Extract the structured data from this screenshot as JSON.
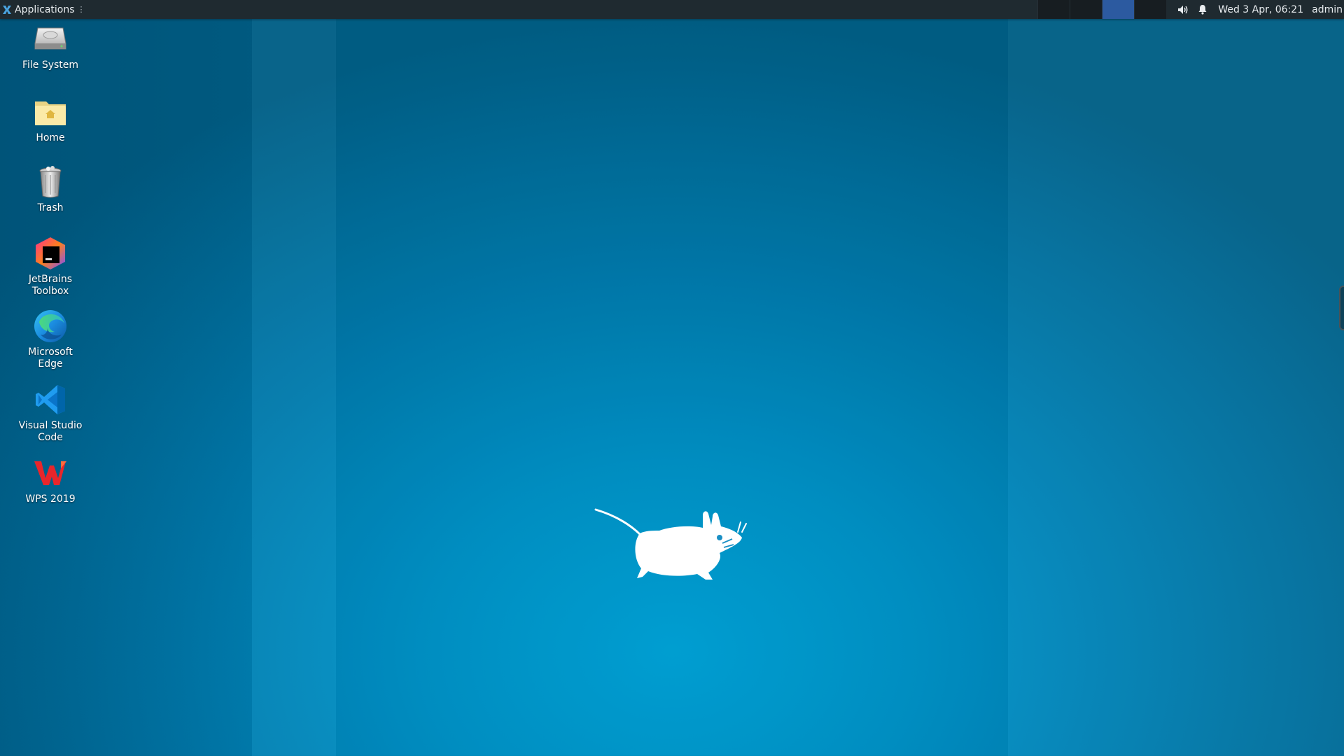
{
  "panel": {
    "applications_label": "Applications",
    "workspaces": [
      "",
      "",
      "",
      ""
    ],
    "active_workspace": 2,
    "clock": "Wed  3 Apr, 06:21",
    "user": "admin"
  },
  "desktop": {
    "icons": [
      {
        "label": "File System",
        "icon": "drive-icon"
      },
      {
        "label": "Home",
        "icon": "home-folder-icon"
      },
      {
        "label": "Trash",
        "icon": "trash-icon"
      },
      {
        "label": "JetBrains Toolbox",
        "icon": "jetbrains-toolbox-icon"
      },
      {
        "label": "Microsoft Edge",
        "icon": "edge-icon"
      },
      {
        "label": "Visual Studio Code",
        "icon": "vscode-icon"
      },
      {
        "label": "WPS 2019",
        "icon": "wps-icon"
      }
    ]
  },
  "colors": {
    "panel_bg": "#1f2a30",
    "active_workspace": "#2c5aa0",
    "wallpaper_center": "#00a5d9",
    "wallpaper_edge": "#005f86"
  }
}
